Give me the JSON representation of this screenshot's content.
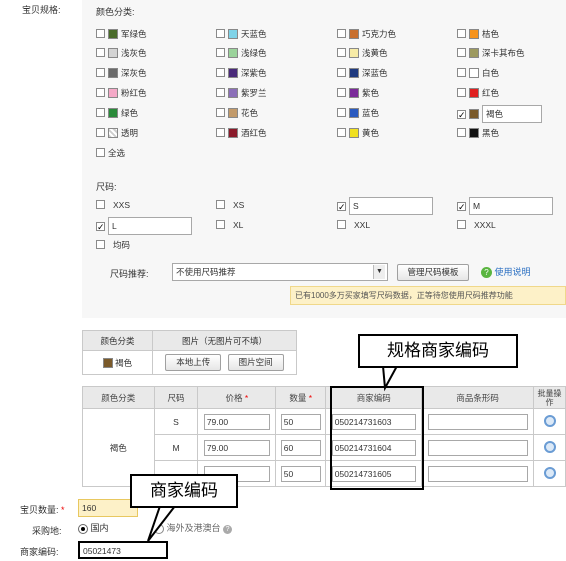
{
  "form": {
    "spec_label": "宝贝规格:",
    "qty_label": "宝贝数量:",
    "qty_value": "160",
    "purchase_label": "采购地:",
    "purchase_options": [
      "国内",
      "海外及港澳台"
    ],
    "merchant_code_label": "商家编码:",
    "merchant_code_value": "05021473"
  },
  "colors": {
    "title": "颜色分类:",
    "items": [
      {
        "name": "军绿色",
        "hex": "#4a6b2a",
        "checked": false
      },
      {
        "name": "天蓝色",
        "hex": "#7fd3e8",
        "checked": false
      },
      {
        "name": "巧克力色",
        "hex": "#c8702f",
        "checked": false
      },
      {
        "name": "桔色",
        "hex": "#f7941d",
        "checked": false
      },
      {
        "name": "浅灰色",
        "hex": "#d4d4d4",
        "checked": false
      },
      {
        "name": "浅绿色",
        "hex": "#9bd39b",
        "checked": false
      },
      {
        "name": "浅黄色",
        "hex": "#f7eba6",
        "checked": false
      },
      {
        "name": "深卡其布色",
        "hex": "#9d9a5f",
        "checked": false
      },
      {
        "name": "深灰色",
        "hex": "#6a6a6a",
        "checked": false
      },
      {
        "name": "深紫色",
        "hex": "#4a2a7a",
        "checked": false
      },
      {
        "name": "深蓝色",
        "hex": "#1f3a80",
        "checked": false
      },
      {
        "name": "白色",
        "hex": "#ffffff",
        "checked": false
      },
      {
        "name": "粉红色",
        "hex": "#f4a9c7",
        "checked": false
      },
      {
        "name": "紫罗兰",
        "hex": "#8b6fb8",
        "checked": false
      },
      {
        "name": "紫色",
        "hex": "#7a2a9a",
        "checked": false
      },
      {
        "name": "红色",
        "hex": "#e02020",
        "checked": false
      },
      {
        "name": "绿色",
        "hex": "#2a8a3a",
        "checked": false
      },
      {
        "name": "花色",
        "hex": "#c29a6a",
        "checked": false
      },
      {
        "name": "蓝色",
        "hex": "#2a5ac0",
        "checked": false
      },
      {
        "name": "褐色",
        "hex": "#7a5a2a",
        "checked": true
      },
      {
        "name": "透明",
        "hex": "#eeeeee",
        "checked": false
      },
      {
        "name": "酒红色",
        "hex": "#8a1a2a",
        "checked": false
      },
      {
        "name": "黄色",
        "hex": "#f0e020",
        "checked": false
      },
      {
        "name": "黑色",
        "hex": "#111111",
        "checked": false
      },
      {
        "name": "全选",
        "hex": "",
        "checked": false
      }
    ]
  },
  "sizes": {
    "title": "尺码:",
    "items": [
      {
        "name": "XXS",
        "checked": false
      },
      {
        "name": "XS",
        "checked": false
      },
      {
        "name": "S",
        "checked": true
      },
      {
        "name": "M",
        "checked": true
      },
      {
        "name": "L",
        "checked": true
      },
      {
        "name": "XL",
        "checked": false
      },
      {
        "name": "XXL",
        "checked": false
      },
      {
        "name": "XXXL",
        "checked": false
      },
      {
        "name": "均码",
        "checked": false
      }
    ],
    "recommend_label": "尺码推荐:",
    "recommend_value": "不使用尺码推荐",
    "manage_button": "管理尺码模板",
    "help_link": "使用说明",
    "notice": "已有1000多万买家填写尺码数据，正等待您使用尺码推荐功能"
  },
  "image_table": {
    "col1": "颜色分类",
    "col2": "图片（无图片可不填）",
    "row_color": "褐色",
    "row_color_hex": "#7a5a2a",
    "upload_local": "本地上传",
    "image_space": "图片空间"
  },
  "sku_table": {
    "headers": [
      "颜色分类",
      "尺码",
      "价格",
      "数量",
      "商家编码",
      "商品条形码",
      "批量操作"
    ],
    "color": "褐色",
    "rows": [
      {
        "size": "S",
        "price": "79.00",
        "qty": "50",
        "code": "050214731603",
        "barcode": ""
      },
      {
        "size": "M",
        "price": "79.00",
        "qty": "60",
        "code": "050214731604",
        "barcode": ""
      },
      {
        "size": "",
        "price": "",
        "qty": "50",
        "code": "050214731605",
        "barcode": ""
      }
    ]
  },
  "callouts": {
    "spec_code": "规格商家编码",
    "merchant_code": "商家编码"
  }
}
